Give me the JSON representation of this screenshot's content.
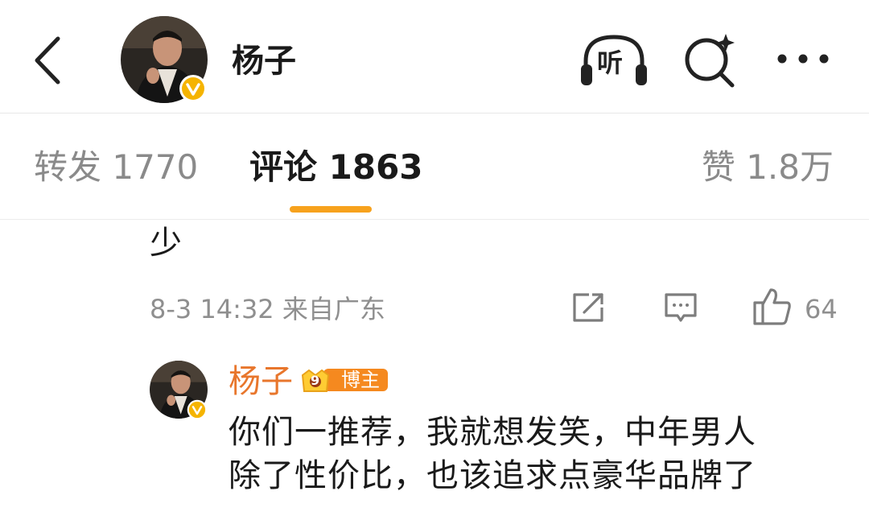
{
  "header": {
    "back_icon": "chevron-left-icon",
    "title": "杨子",
    "listen_label": "听",
    "search_icon": "search-sparkle-icon",
    "more_icon": "more-dots-icon"
  },
  "tabs": {
    "repost": "转发 1770",
    "comment": "评论 1863",
    "like": "赞 1.8万",
    "active": "comment",
    "accent_color": "#f7a21d"
  },
  "comment": {
    "text_tail": "少",
    "meta": "8-3 14:32 来自广东",
    "like_count": "64"
  },
  "reply": {
    "author": "杨子",
    "badge_level": "9",
    "badge_label": "博主",
    "name_color": "#e8762c",
    "lines": [
      "你们一推荐，我就想发笑，中年男人",
      "除了性价比，也该追求点豪华品牌了"
    ]
  }
}
